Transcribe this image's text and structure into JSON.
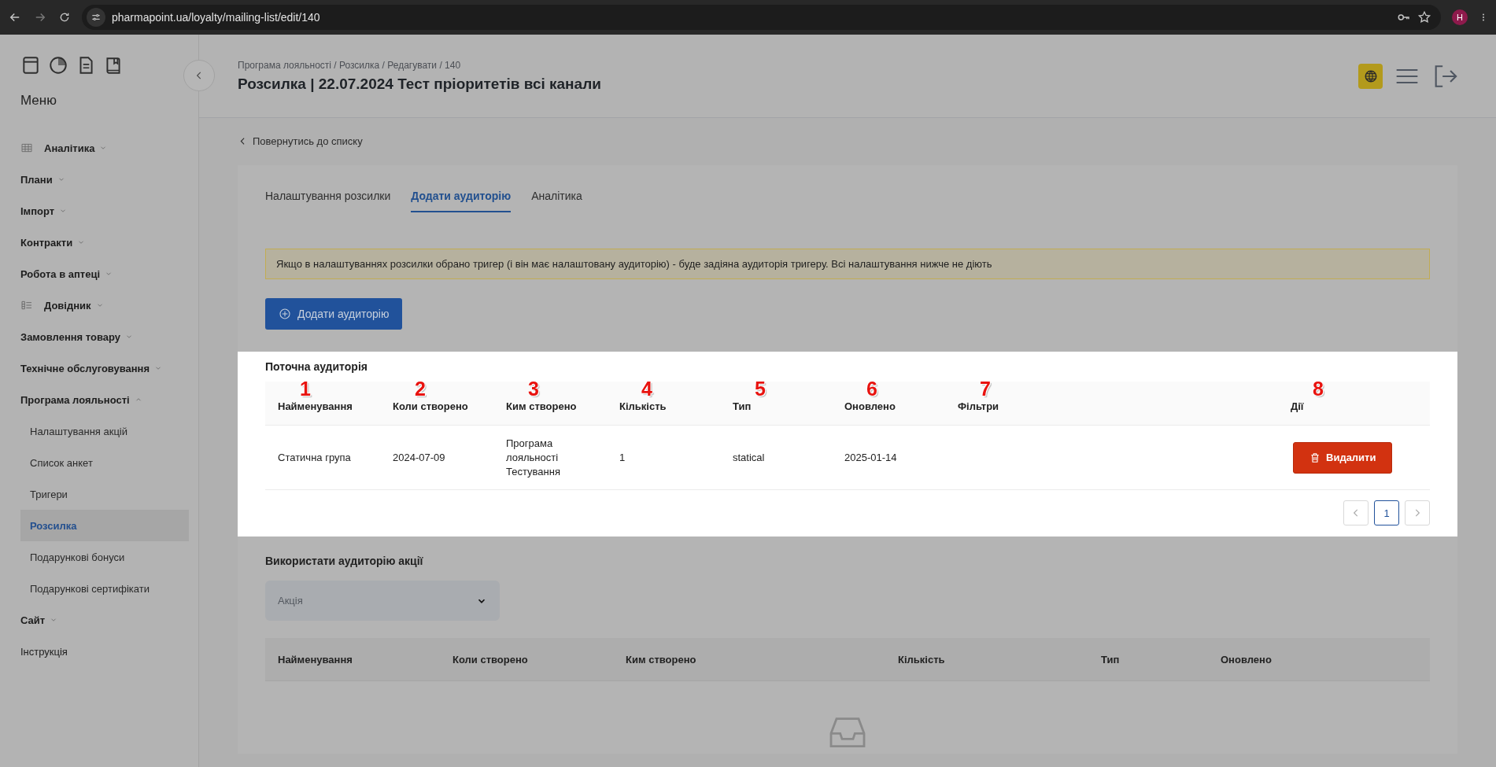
{
  "browser": {
    "url": "pharmapoint.ua/loyalty/mailing-list/edit/140",
    "profile_initial": "H"
  },
  "sidebar": {
    "title": "Меню",
    "items": [
      {
        "label": "Аналітика",
        "kind": "grid",
        "expanded": false
      },
      {
        "label": "Плани",
        "kind": "group",
        "expanded": false
      },
      {
        "label": "Імпорт",
        "kind": "group",
        "expanded": false
      },
      {
        "label": "Контракти",
        "kind": "group",
        "expanded": false
      },
      {
        "label": "Робота в аптеці",
        "kind": "group",
        "expanded": false
      },
      {
        "label": "Довідник",
        "kind": "list",
        "expanded": false
      },
      {
        "label": "Замовлення товару",
        "kind": "group",
        "expanded": false
      },
      {
        "label": "Технічне обслуговування",
        "kind": "group",
        "expanded": false
      },
      {
        "label": "Програма лояльності",
        "kind": "group",
        "expanded": true,
        "children": [
          {
            "label": "Налаштування акцій",
            "selected": false
          },
          {
            "label": "Список анкет",
            "selected": false
          },
          {
            "label": "Тригери",
            "selected": false
          },
          {
            "label": "Розсилка",
            "selected": true
          },
          {
            "label": "Подарункові бонуси",
            "selected": false
          },
          {
            "label": "Подарункові сертифікати",
            "selected": false
          }
        ]
      },
      {
        "label": "Сайт",
        "kind": "group",
        "expanded": false
      },
      {
        "label": "Інструкція",
        "kind": "link"
      }
    ]
  },
  "header": {
    "breadcrumb": "Програма лояльності / Розсилка / Редагувати / 140",
    "title": "Розсилка | 22.07.2024 Тест пріоритетів всі канали"
  },
  "back_link": "Повернутись до списку",
  "tabs": [
    {
      "label": "Налаштування розсилки",
      "selected": false
    },
    {
      "label": "Додати аудиторію",
      "selected": true
    },
    {
      "label": "Аналітика",
      "selected": false
    }
  ],
  "alert": "Якщо в налаштуваннях розсилки обрано тригер (і він має налаштовану аудиторію) - буде задіяна аудиторія тригеру. Всі налаштування нижче не діють",
  "add_button": "Додати аудиторію",
  "current_audience": {
    "title": "Поточна аудиторія",
    "columns": [
      {
        "label": "Найменування",
        "marker": "1"
      },
      {
        "label": "Коли створено",
        "marker": "2"
      },
      {
        "label": "Ким створено",
        "marker": "3"
      },
      {
        "label": "Кількість",
        "marker": "4"
      },
      {
        "label": "Тип",
        "marker": "5"
      },
      {
        "label": "Оновлено",
        "marker": "6"
      },
      {
        "label": "Фільтри",
        "marker": "7"
      },
      {
        "label": "Дії",
        "marker": "8"
      }
    ],
    "rows": [
      {
        "cells": [
          "Статична група",
          "2024-07-09",
          "Програма лояльності Тестування",
          "1",
          "statical",
          "2025-01-14",
          null
        ],
        "action": "Видалити"
      }
    ],
    "pages": [
      {
        "label": "1",
        "selected": true
      }
    ]
  },
  "promo_audience": {
    "title": "Використати аудиторію акції",
    "select": {
      "placeholder": "Акція"
    },
    "columns": [
      "Найменування",
      "Коли створено",
      "Ким створено",
      "Кількість",
      "Тип",
      "Оновлено"
    ]
  }
}
